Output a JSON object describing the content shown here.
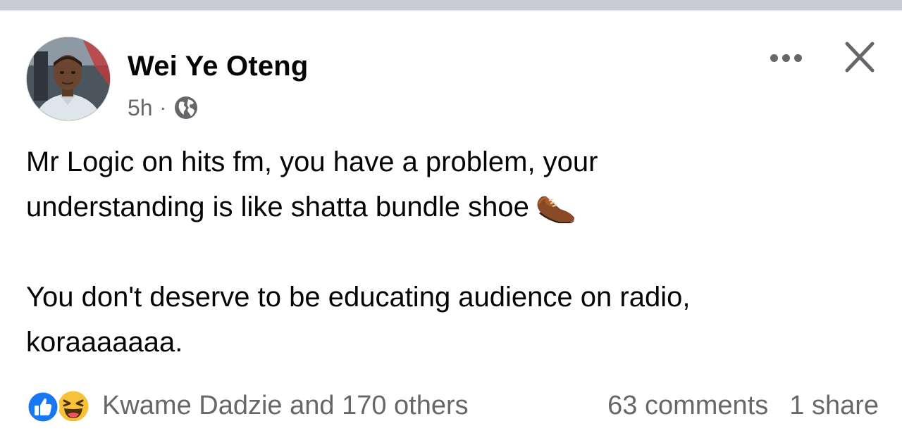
{
  "post": {
    "author": "Wei Ye Oteng",
    "time": "5h",
    "separator": "·",
    "privacy_icon": "globe-icon",
    "text_line1": "Mr Logic on hits fm, you have a problem, your",
    "text_line2": "understanding is like shatta bundle shoe",
    "emoji": "shoe-icon",
    "text_line3": "You don't deserve to be educating audience on radio,",
    "text_line4": "koraaaaaaa."
  },
  "header_actions": {
    "more_icon": "more-options-icon",
    "close_icon": "close-icon"
  },
  "footer": {
    "reaction_icons": [
      "like-icon",
      "haha-icon"
    ],
    "reactors": "Kwame Dadzie and 170 others",
    "comments": "63 comments",
    "shares": "1 share"
  },
  "colors": {
    "text": "#050505",
    "secondary_text": "#65676b",
    "like_blue": "#1877f2",
    "haha_yellow": "#f7c23a",
    "divider": "#c9ccd1"
  }
}
